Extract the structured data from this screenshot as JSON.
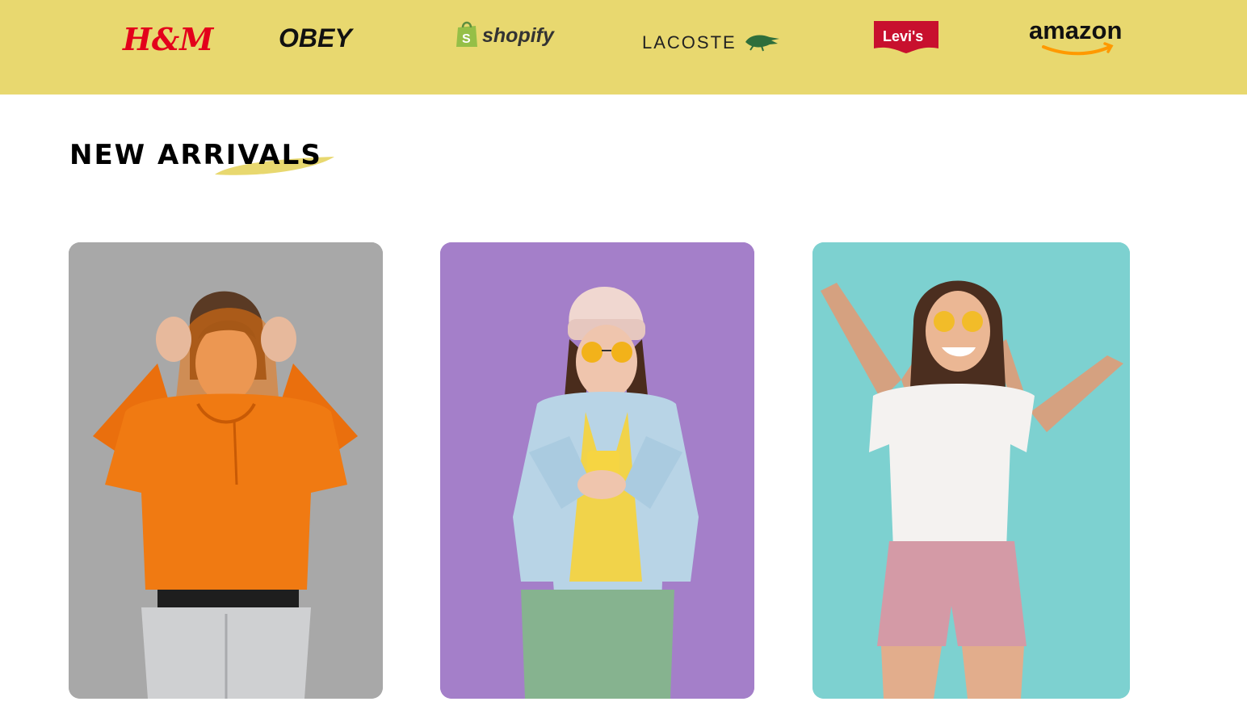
{
  "brands": [
    {
      "name": "H&M",
      "color": "#e3001b"
    },
    {
      "name": "OBEY",
      "color": "#111111"
    },
    {
      "name": "shopify",
      "color": "#333333",
      "accent": "#95bf47"
    },
    {
      "name": "LACOSTE",
      "color": "#222222",
      "accent": "#2e6e3b"
    },
    {
      "name": "Levi's",
      "color": "#ffffff",
      "accent": "#c8102e"
    },
    {
      "name": "amazon",
      "color": "#111111",
      "accent": "#ff9900"
    }
  ],
  "section": {
    "title": "NEW ARRIVALS",
    "accent_color": "#e8d86f"
  },
  "products": [
    {
      "id": "orange-hoodie",
      "bg": "#a8a8a8",
      "garment": "#f07a12"
    },
    {
      "id": "denim-jacket",
      "bg": "#a47fc9",
      "garment": "#b8d4e6"
    },
    {
      "id": "white-tee",
      "bg": "#7dd1d0",
      "garment": "#f4f2f0"
    }
  ],
  "colors": {
    "header_bg": "#e8d86f",
    "page_bg": "#ffffff"
  }
}
